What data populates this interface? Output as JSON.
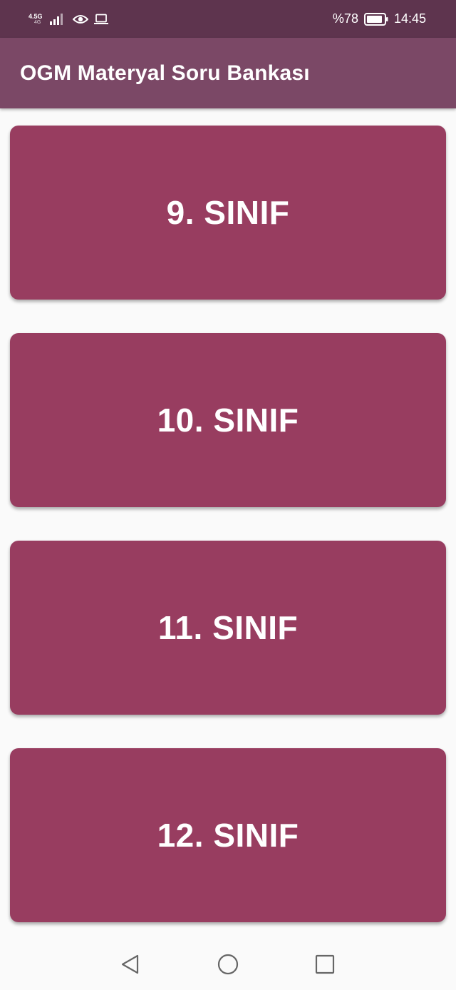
{
  "status_bar": {
    "network_type": "4.5G",
    "network_sub": "4G",
    "battery_percent": "%78",
    "time": "14:45",
    "icons": [
      "signal-icon",
      "eye-icon",
      "laptop-icon",
      "battery-icon"
    ]
  },
  "app_bar": {
    "title": "OGM Materyal Soru Bankası"
  },
  "grades": [
    {
      "label": "9. SINIF"
    },
    {
      "label": "10. SINIF"
    },
    {
      "label": "11. SINIF"
    },
    {
      "label": "12. SINIF"
    }
  ],
  "nav_bar": {
    "icons": [
      "back-icon",
      "home-icon",
      "recents-icon"
    ]
  },
  "colors": {
    "status_bar": "#5e344e",
    "app_bar": "#7b4866",
    "card": "#983d60",
    "background": "#fafafa"
  }
}
